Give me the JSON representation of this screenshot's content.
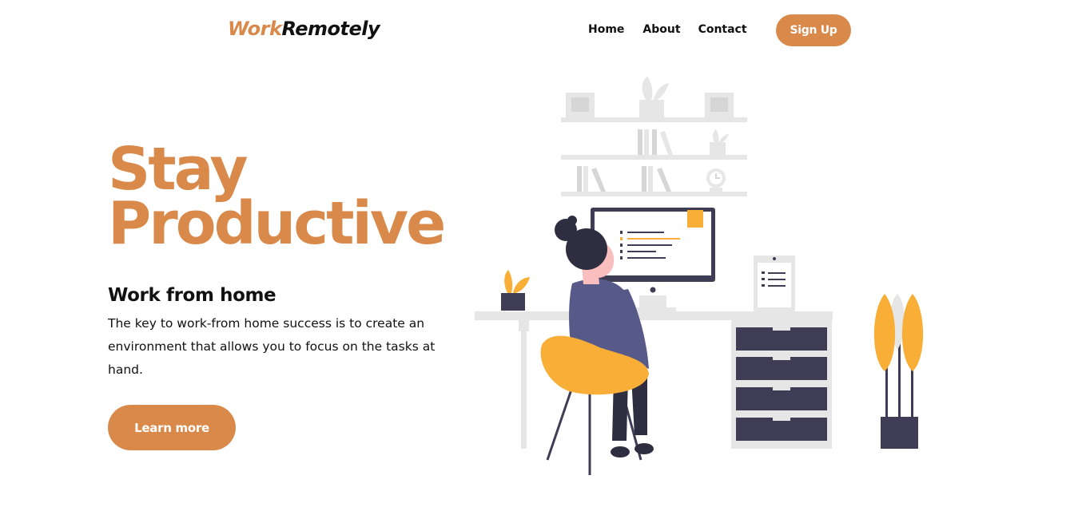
{
  "header": {
    "logo_work": "Work",
    "logo_remotely": "Remotely",
    "nav": {
      "home": "Home",
      "about": "About",
      "contact": "Contact"
    },
    "signup_label": "Sign Up"
  },
  "hero": {
    "title_line1": "Stay",
    "title_line2": "Productive",
    "subtitle": "Work from home",
    "description": "The key to work-from home success is to create an environment that allows you to focus on the tasks at hand.",
    "cta_label": "Learn more"
  },
  "colors": {
    "accent": "#d98a4b",
    "illustration_yellow": "#f9ae37",
    "illustration_dark": "#3f3d56",
    "illustration_grey": "#e6e6e6"
  },
  "icons": {
    "illustration": "woman-working-at-desk-illustration"
  }
}
